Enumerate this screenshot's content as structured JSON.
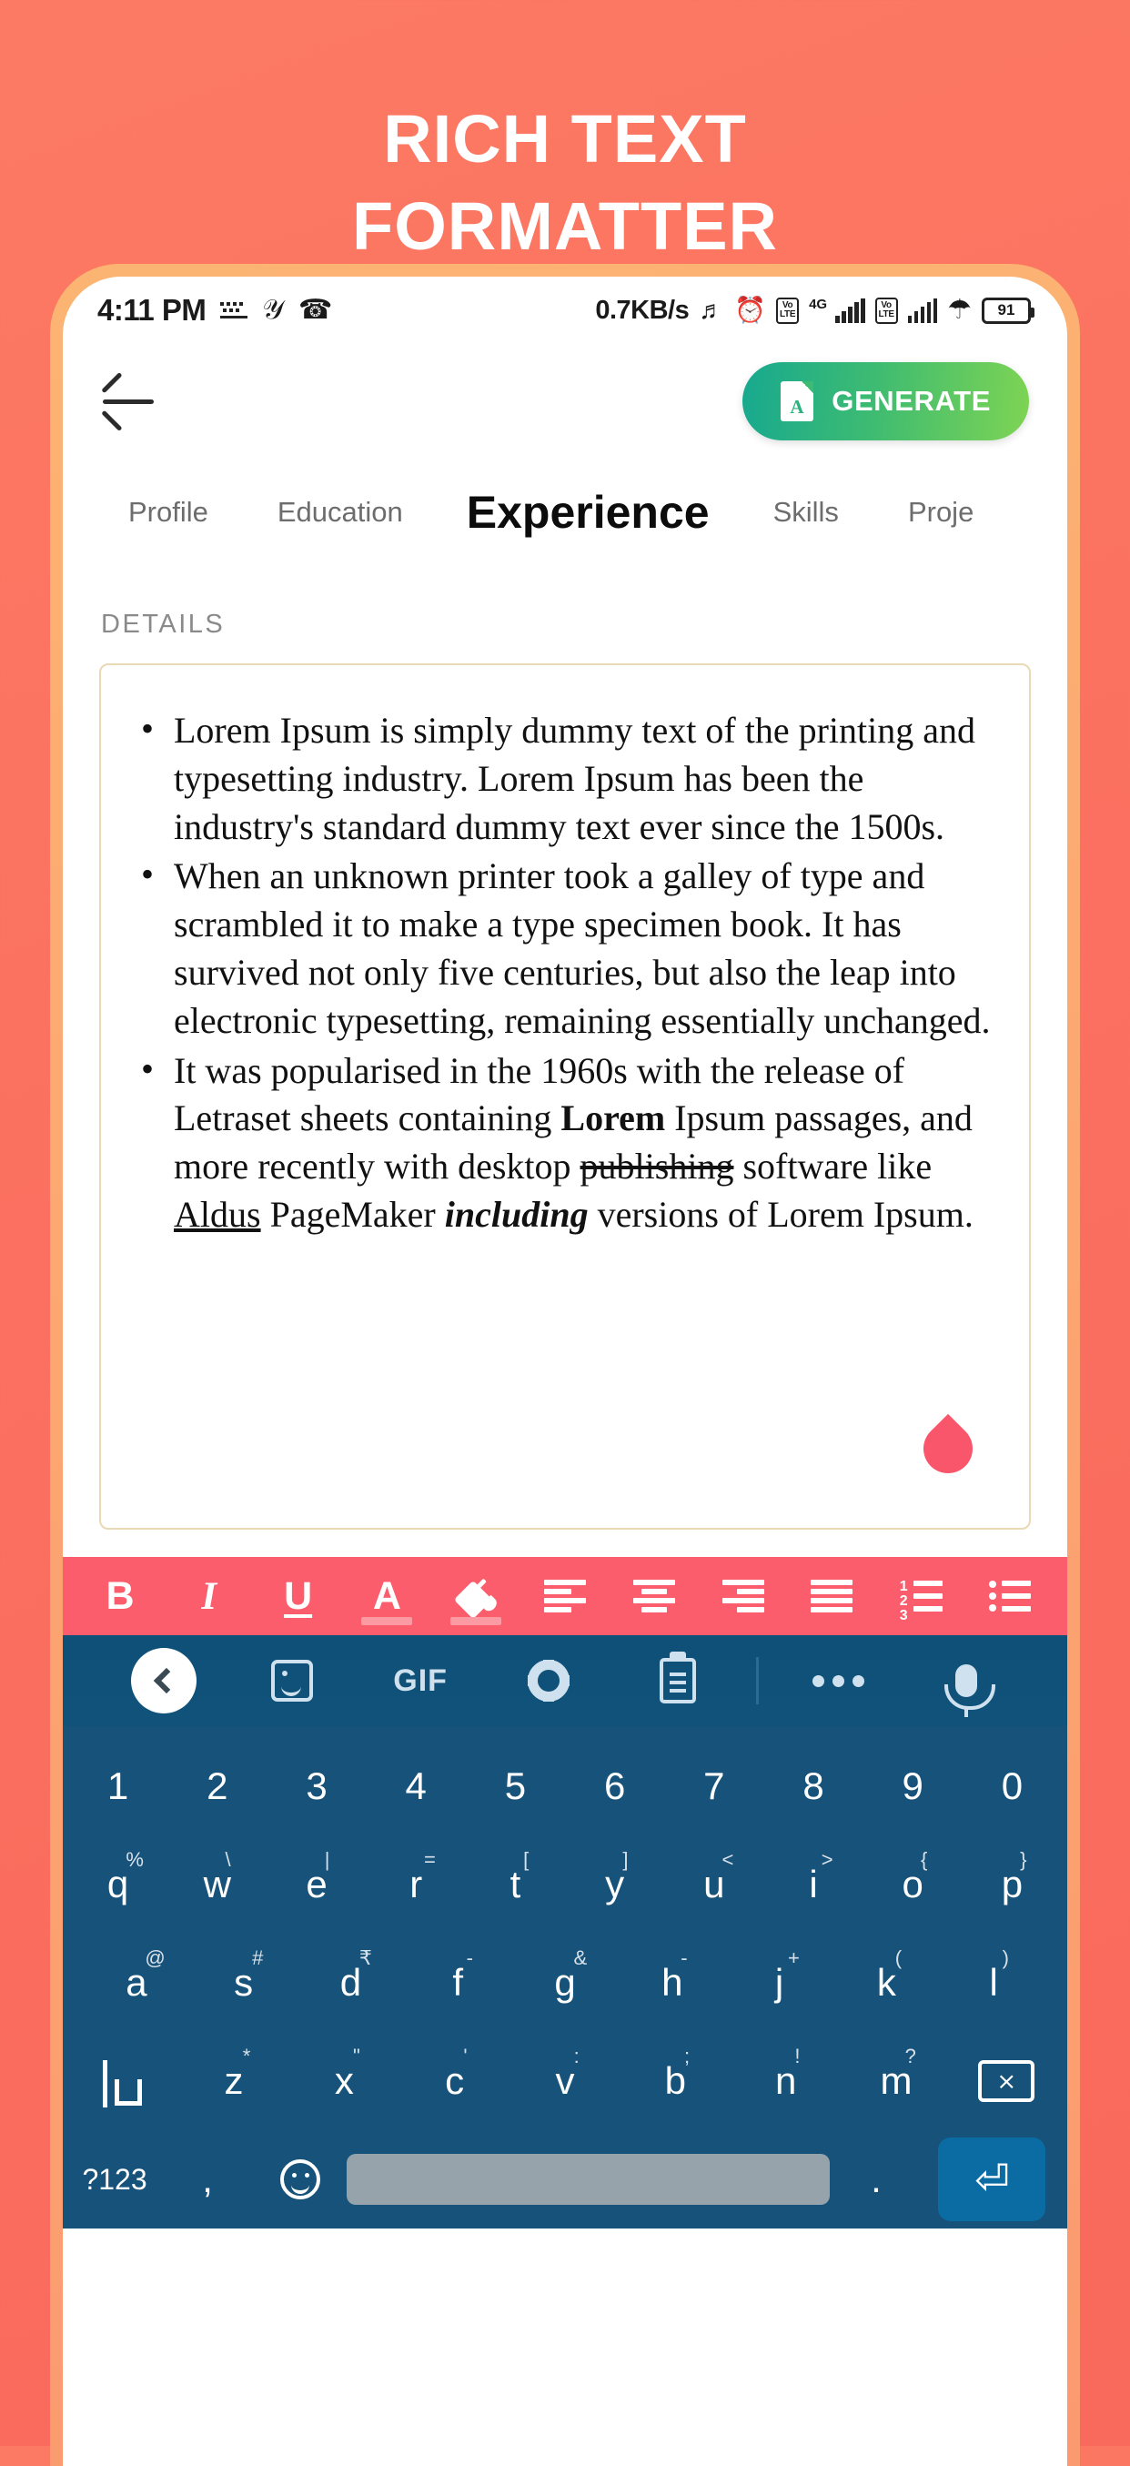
{
  "promo": {
    "line1": "RICH TEXT",
    "line2": "FORMATTER",
    "bg_color": "#fb7060"
  },
  "status_bar": {
    "time": "4:11 PM",
    "network_speed": "0.7KB/s",
    "battery_percent": "91",
    "volte_label_top": "Vo",
    "volte_label_bottom": "LTE",
    "network_type": "4G",
    "icons": [
      "keyboard-icon",
      "yandex-icon",
      "whatsapp-icon",
      "headset-icon",
      "alarm-icon",
      "volte-icon",
      "signal-icon",
      "volte-icon",
      "signal-icon",
      "wifi-icon",
      "battery-icon"
    ]
  },
  "app_header": {
    "back_label": "back",
    "generate_label": "GENERATE",
    "generate_gradient_from": "#17a98f",
    "generate_gradient_to": "#7ed453"
  },
  "tabs": [
    {
      "label": "Profile",
      "active": false
    },
    {
      "label": "Education",
      "active": false
    },
    {
      "label": "Experience",
      "active": true
    },
    {
      "label": "Skills",
      "active": false
    },
    {
      "label": "Proje",
      "active": false
    }
  ],
  "section": {
    "details_label": "DETAILS"
  },
  "editor": {
    "border_color": "#e9d9b4",
    "cursor_handle_color": "#fa566b",
    "bullets": [
      {
        "runs": [
          {
            "text": "Lorem Ipsum is simply dummy text of the printing and typesetting industry. Lorem Ipsum has been the industry's standard dummy text ever since the 1500s.",
            "style": "normal"
          }
        ]
      },
      {
        "runs": [
          {
            "text": "When an unknown printer took a galley of type and scrambled it to make a type specimen book. It has survived not only five centuries, but also the leap into electronic typesetting, remaining essentially unchanged.",
            "style": "normal"
          }
        ]
      },
      {
        "runs": [
          {
            "text": "It was popularised in the 1960s with the release of Letraset sheets containing ",
            "style": "normal"
          },
          {
            "text": "Lorem",
            "style": "bold"
          },
          {
            "text": " Ipsum passages, and more recently with desktop ",
            "style": "normal"
          },
          {
            "text": "publishing",
            "style": "strikethrough"
          },
          {
            "text": " software like ",
            "style": "normal"
          },
          {
            "text": "Aldus",
            "style": "underline"
          },
          {
            "text": " PageMaker ",
            "style": "normal"
          },
          {
            "text": "including",
            "style": "bold-italic"
          },
          {
            "text": " versions of Lorem Ipsum.",
            "style": "normal"
          }
        ]
      }
    ]
  },
  "format_toolbar": {
    "bg_color": "#fb5d6d",
    "swatch_color": "#fc9aa4",
    "buttons": [
      {
        "name": "bold-button",
        "glyph": "B"
      },
      {
        "name": "italic-button",
        "glyph": "I"
      },
      {
        "name": "underline-button",
        "glyph": "U"
      },
      {
        "name": "text-color-button",
        "glyph": "A"
      },
      {
        "name": "fill-color-button",
        "glyph": ""
      },
      {
        "name": "align-left-button",
        "glyph": ""
      },
      {
        "name": "align-center-button",
        "glyph": ""
      },
      {
        "name": "align-right-button",
        "glyph": ""
      },
      {
        "name": "align-justify-button",
        "glyph": ""
      },
      {
        "name": "numbered-list-button",
        "glyph": ""
      },
      {
        "name": "bullet-list-button",
        "glyph": ""
      }
    ],
    "numbered_marks": [
      "1",
      "2",
      "3"
    ]
  },
  "keyboard": {
    "bg_color": "#17527a",
    "toolbar": {
      "items": [
        "back-chevron-button",
        "sticker-button",
        "gif-button",
        "settings-gear-button",
        "clipboard-button",
        "divider",
        "more-options-button",
        "microphone-button"
      ],
      "gif_label": "GIF"
    },
    "rows": {
      "numbers": [
        "1",
        "2",
        "3",
        "4",
        "5",
        "6",
        "7",
        "8",
        "9",
        "0"
      ],
      "row1": [
        {
          "key": "q",
          "sup": "%"
        },
        {
          "key": "w",
          "sup": "\\"
        },
        {
          "key": "e",
          "sup": "|"
        },
        {
          "key": "r",
          "sup": "="
        },
        {
          "key": "t",
          "sup": "["
        },
        {
          "key": "y",
          "sup": "]"
        },
        {
          "key": "u",
          "sup": "<"
        },
        {
          "key": "i",
          "sup": ">"
        },
        {
          "key": "o",
          "sup": "{"
        },
        {
          "key": "p",
          "sup": "}"
        }
      ],
      "row2": [
        {
          "key": "a",
          "sup": "@"
        },
        {
          "key": "s",
          "sup": "#"
        },
        {
          "key": "d",
          "sup": "₹"
        },
        {
          "key": "f",
          "sup": "-"
        },
        {
          "key": "g",
          "sup": "&"
        },
        {
          "key": "h",
          "sup": "-"
        },
        {
          "key": "j",
          "sup": "+"
        },
        {
          "key": "k",
          "sup": "("
        },
        {
          "key": "l",
          "sup": ")"
        }
      ],
      "row3": [
        {
          "key": "z",
          "sup": "*"
        },
        {
          "key": "x",
          "sup": "\""
        },
        {
          "key": "c",
          "sup": "'"
        },
        {
          "key": "v",
          "sup": ":"
        },
        {
          "key": "b",
          "sup": ";"
        },
        {
          "key": "n",
          "sup": "!"
        },
        {
          "key": "m",
          "sup": "?"
        }
      ],
      "bottom": {
        "symbols_label": "?123",
        "comma": ",",
        "period": ".",
        "emoji": "emoji-button",
        "space": "space-bar",
        "enter": "⏎"
      },
      "backspace_glyph": "⨯",
      "shift_glyph": "shift"
    }
  }
}
